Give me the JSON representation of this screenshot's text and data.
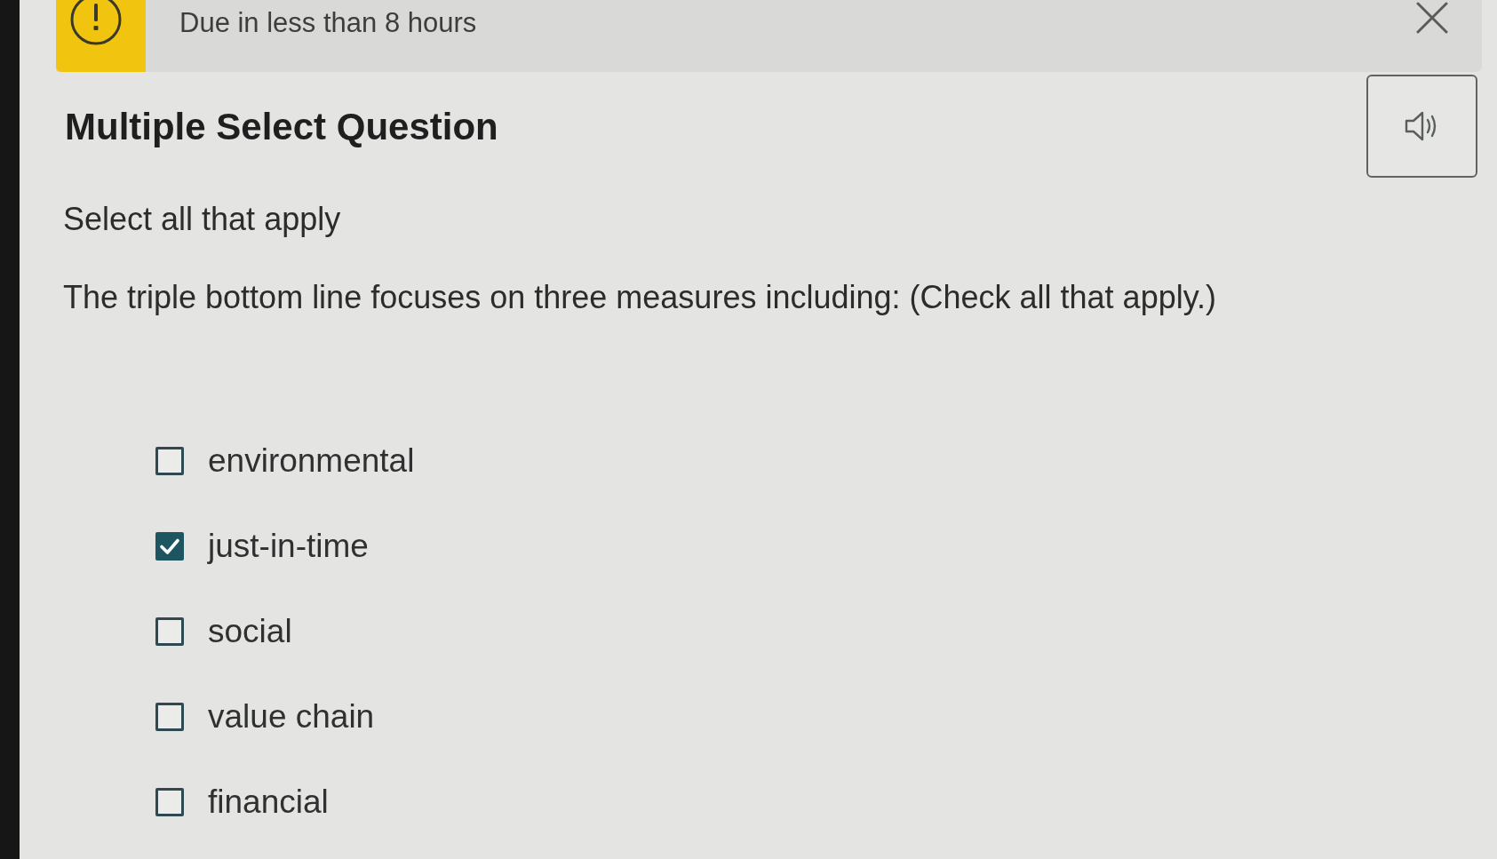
{
  "banner": {
    "message": "Due in less than 8 hours"
  },
  "question": {
    "type_label": "Multiple Select Question",
    "instruction": "Select all that apply",
    "prompt": "The triple bottom line focuses on three measures including: (Check all that apply.)"
  },
  "options": [
    {
      "label": "environmental",
      "checked": false
    },
    {
      "label": "just-in-time",
      "checked": true
    },
    {
      "label": "social",
      "checked": false
    },
    {
      "label": "value chain",
      "checked": false
    },
    {
      "label": "financial",
      "checked": false
    }
  ]
}
